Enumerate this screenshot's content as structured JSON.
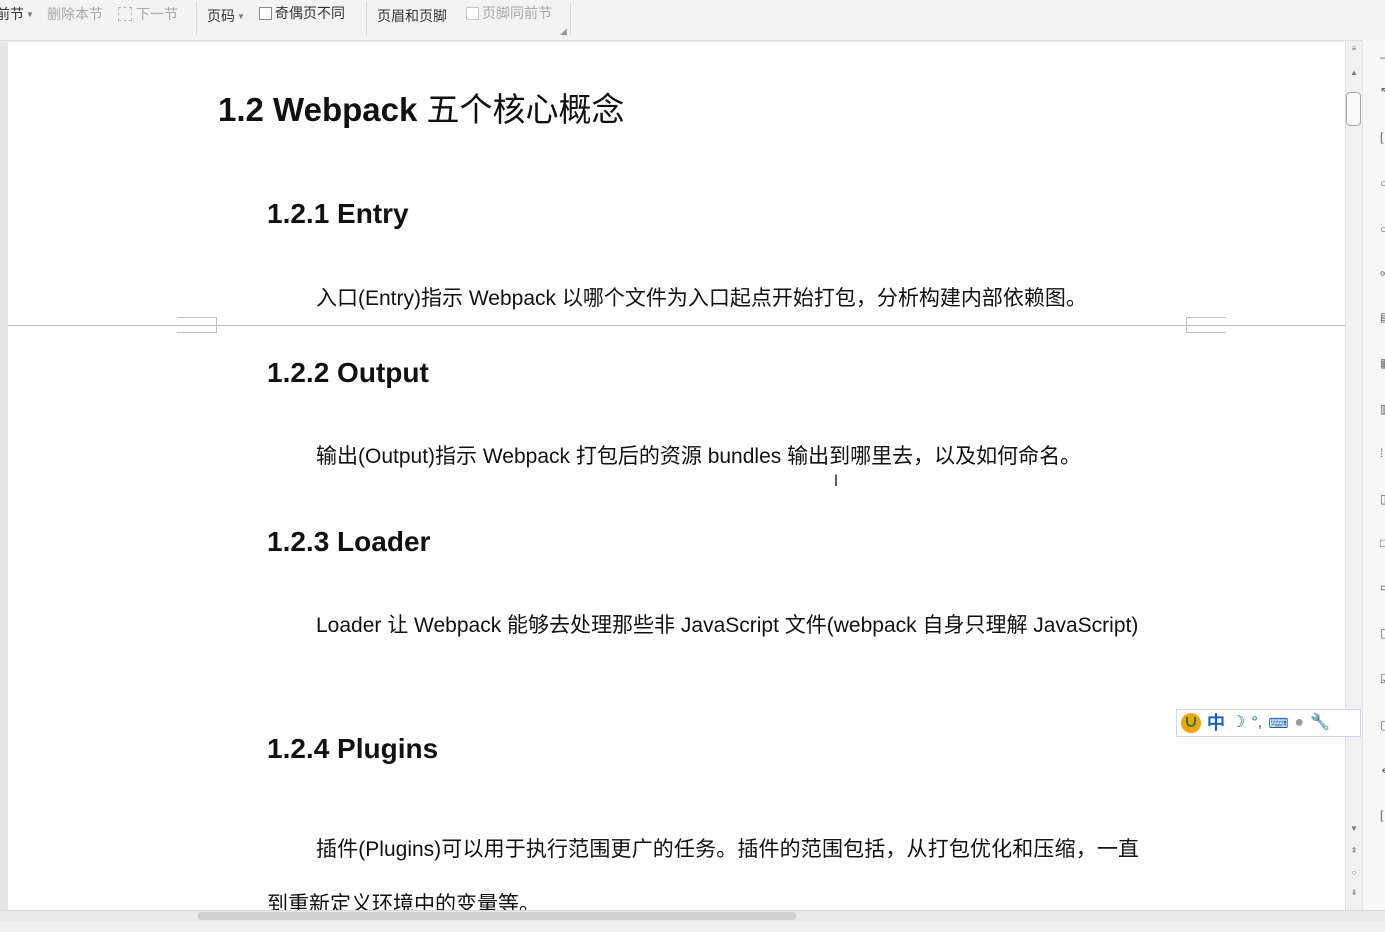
{
  "toolbar": {
    "link_prev_label": "前节",
    "delete_section_label": "删除本节",
    "next_section_label": "下一节",
    "page_number_label": "页码",
    "odd_even_label": "奇偶页不同",
    "header_footer_label": "页眉和页脚",
    "same_as_prev_label": "页脚同前节"
  },
  "document": {
    "title_latin": "1.2 Webpack",
    "title_cjk": "五个核心概念",
    "sections": [
      {
        "heading": "1.2.1 Entry",
        "body": "入口(Entry)指示  Webpack  以哪个文件为入口起点开始打包，分析构建内部依赖图。"
      },
      {
        "heading": "1.2.2 Output",
        "body": "输出(Output)指示  Webpack  打包后的资源  bundles  输出到哪里去，以及如何命名。"
      },
      {
        "heading": "1.2.3 Loader",
        "body": "Loader 让 Webpack 能够去处理那些非 JavaScript 文件(webpack 自身只理解 JavaScript)"
      },
      {
        "heading": "1.2.4 Plugins",
        "body": "插件(Plugins)可以用于执行范围更广的任务。插件的范围包括，从打包优化和压缩，一直到重新定义环境中的变量等。"
      }
    ]
  },
  "ime": {
    "mode_label": "中",
    "moon_glyph": "☽",
    "punct_glyph": "°,",
    "keyboard_glyph": "⌨",
    "user_glyph": "●",
    "tool_glyph": "🔧"
  },
  "icons": {
    "brand_color": "#f2a31a",
    "ime_blue": "#1d5fbf"
  }
}
